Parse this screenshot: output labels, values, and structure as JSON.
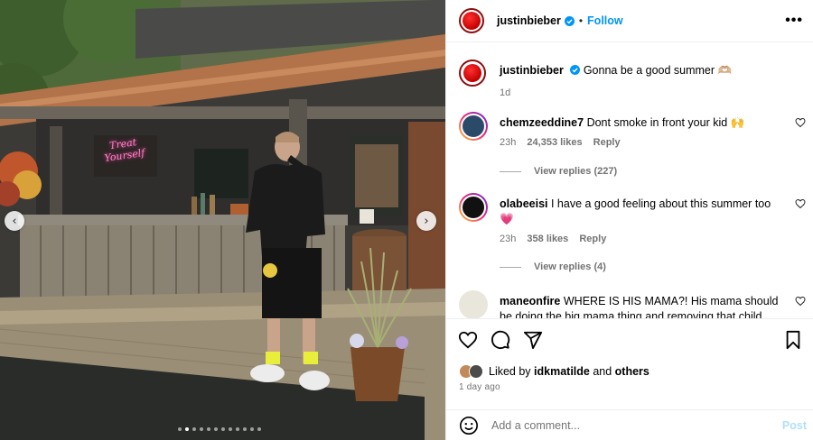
{
  "post": {
    "author": "justinbieber",
    "follow_label": "Follow",
    "separator": "•",
    "more_label": "•••",
    "caption": "Gonna be a good summer 🫶🏼",
    "caption_age": "1d",
    "neon_sign": "Treat Yourself",
    "carousel": {
      "prev": "‹",
      "next": "›",
      "slides": 12,
      "active_slide": 1
    }
  },
  "comments": [
    {
      "username": "chemzeeddine7",
      "text": "Dont smoke in front your kid 🙌",
      "age": "23h",
      "likes": "24,353 likes",
      "reply_label": "Reply",
      "view_replies": "View replies (227)"
    },
    {
      "username": "olabeeisi",
      "text": "I have a good feeling about this summer too 💗",
      "age": "23h",
      "likes": "358 likes",
      "reply_label": "Reply",
      "view_replies": "View replies (4)"
    },
    {
      "username": "maneonfire",
      "text": "WHERE IS HIS MAMA?! His mama should be doing the big mama thing and removing that child from"
    }
  ],
  "footer": {
    "liked_prefix": "Liked by ",
    "liked_user": "idkmatilde",
    "liked_and": " and ",
    "liked_others": "others",
    "time_ago": "1 day ago",
    "comment_placeholder": "Add a comment...",
    "post_label": "Post"
  },
  "colors": {
    "accent_blue": "#0095f6",
    "post_disabled": "#b2dffc",
    "muted_text": "#737373",
    "verified_blue": "#0095f6"
  },
  "icons": [
    "heart-icon",
    "comment-icon",
    "share-icon",
    "bookmark-icon",
    "emoji-icon",
    "more-icon",
    "verified-icon"
  ]
}
